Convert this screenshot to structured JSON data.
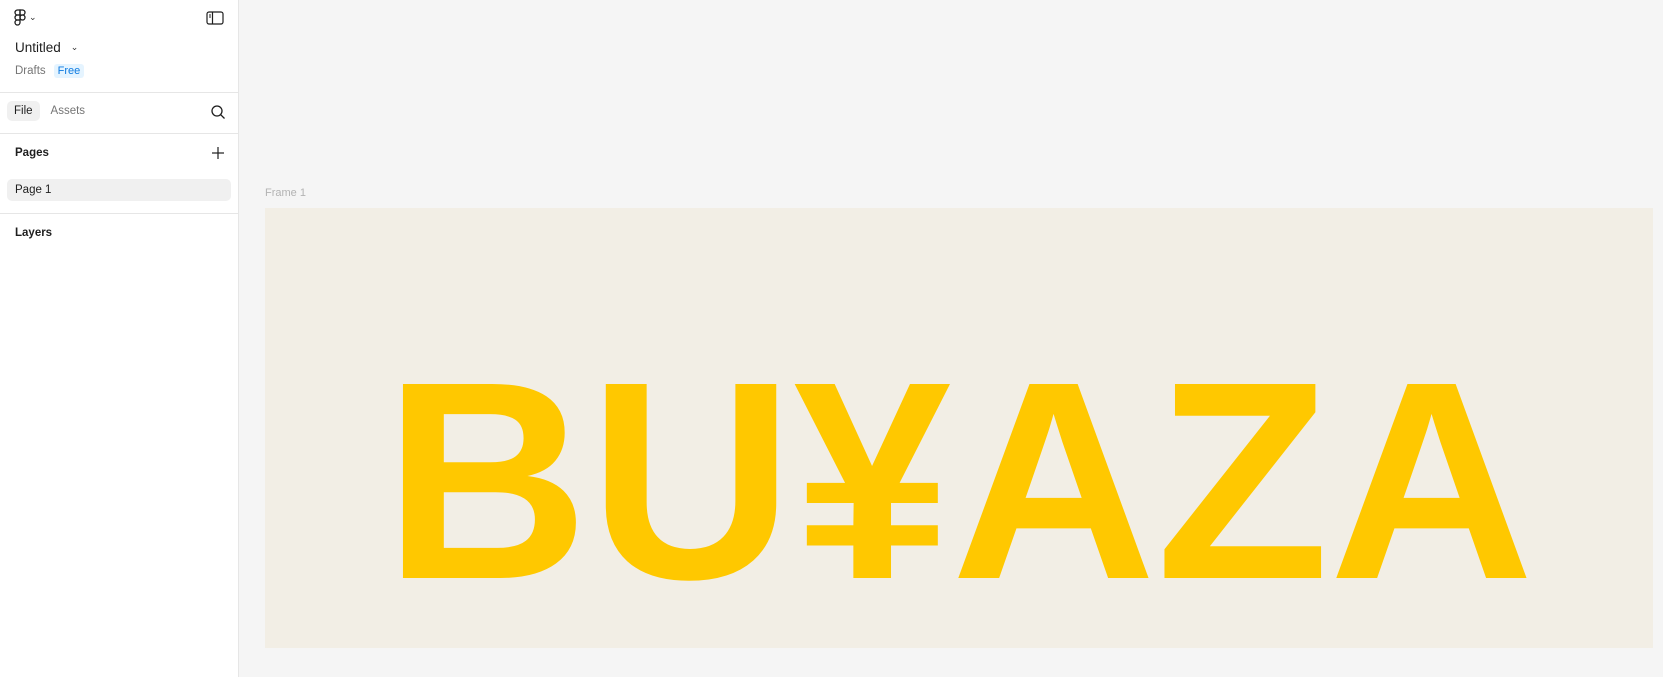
{
  "header": {
    "file_title": "Untitled",
    "location": "Drafts",
    "plan_badge": "Free"
  },
  "tabs": [
    {
      "label": "File",
      "active": true
    },
    {
      "label": "Assets",
      "active": false
    }
  ],
  "pages": {
    "title": "Pages",
    "items": [
      {
        "label": "Page 1",
        "selected": true
      }
    ]
  },
  "layers": {
    "title": "Layers"
  },
  "canvas": {
    "frame_name": "Frame 1",
    "frame_text": "BU¥AZA",
    "frame_background": "#f2eee5",
    "text_color": "#ffc800"
  },
  "icons": {
    "logo": "figma-logo-icon",
    "panel": "panel-toggle-icon",
    "search": "search-icon",
    "add": "plus-icon"
  }
}
